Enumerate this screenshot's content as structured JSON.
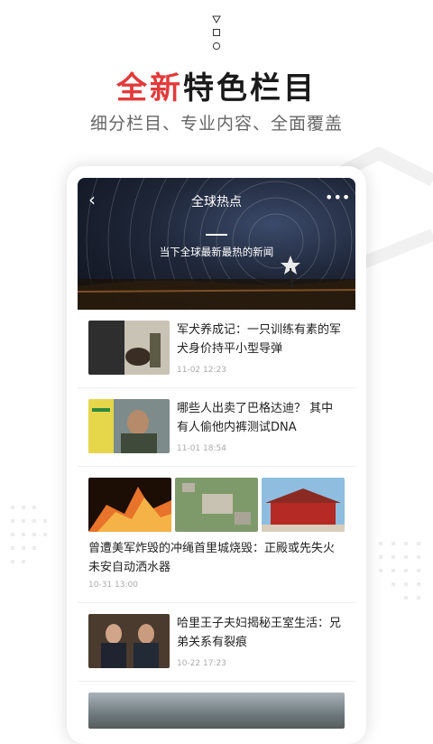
{
  "hero": {
    "title_accent": "全新",
    "title_rest": "特色栏目",
    "subtitle": "细分栏目、专业内容、全面覆盖"
  },
  "status": {
    "icons": [
      "triangle-icon",
      "square-icon",
      "circle-icon"
    ]
  },
  "nav": {
    "back_glyph": "‹",
    "title": "全球热点",
    "more_glyph": "•••"
  },
  "banner": {
    "subtitle": "当下全球最新最热的新闻"
  },
  "news": [
    {
      "title": "军犬养成记：一只训练有素的军犬身价持平小型导弹",
      "time": "11-02 12:23"
    },
    {
      "title": "哪些人出卖了巴格达迪？ 其中有人偷他内裤测试DNA",
      "time": "11-01 18:54"
    }
  ],
  "multi_news": {
    "title": "曾遭美军炸毁的冲绳首里城烧毁：正殿或先失火 未安自动洒水器",
    "time": "10-31 13:00"
  },
  "news2": [
    {
      "title": "哈里王子夫妇揭秘王室生活：兄弟关系有裂痕",
      "time": "10-22 17:23"
    }
  ],
  "colors": {
    "accent": "#e23a3a",
    "text_dark": "#1a1a1a",
    "subtitle": "#666666"
  }
}
